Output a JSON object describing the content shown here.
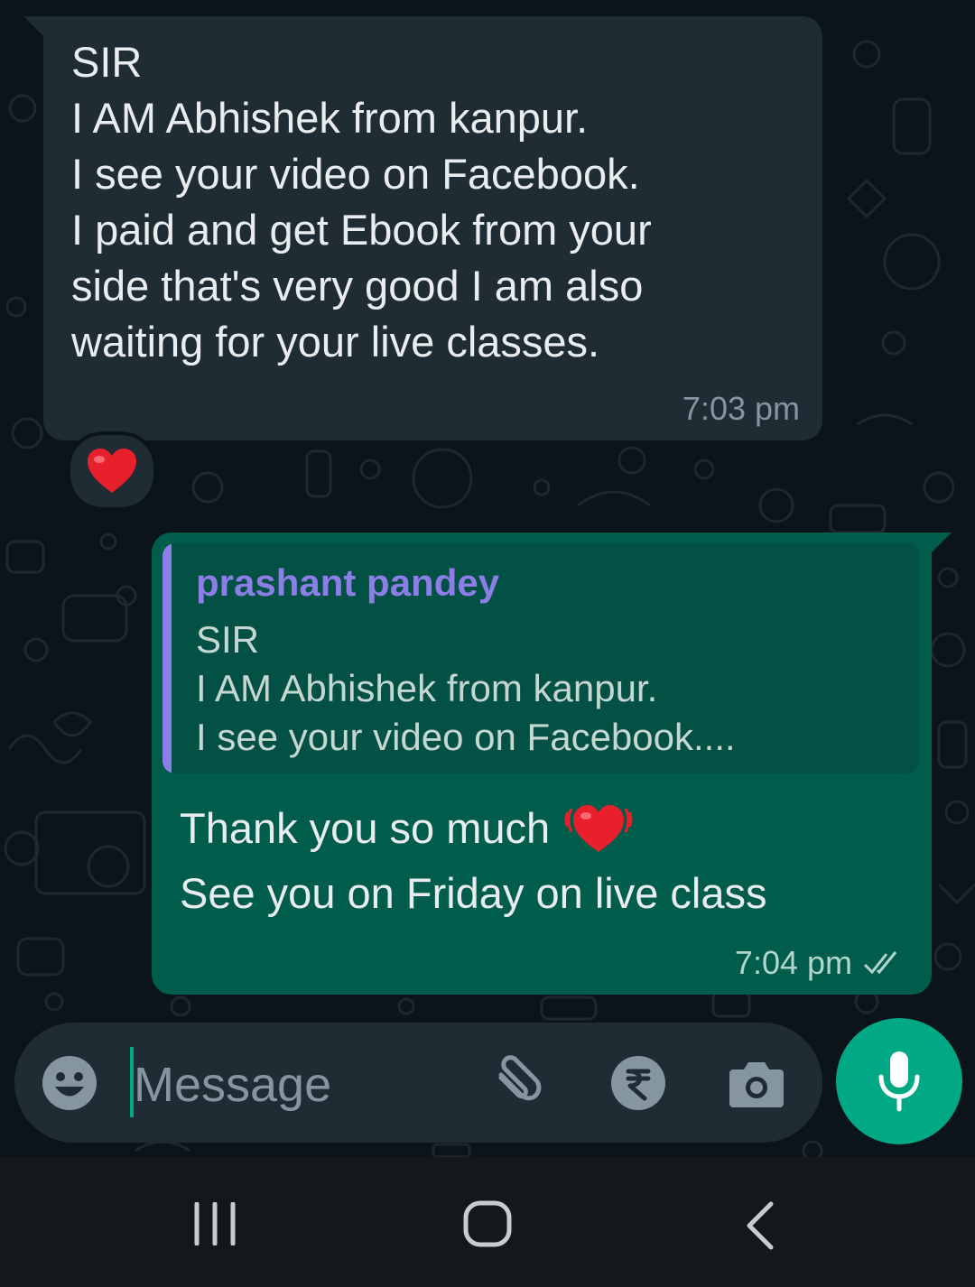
{
  "colors": {
    "background": "#0b141a",
    "incoming_bubble": "#202c33",
    "outgoing_bubble": "#005c4b",
    "quote_author": "#8c7ee6",
    "accent": "#00a884"
  },
  "messages": {
    "incoming": {
      "text": "SIR\nI AM Abhishek from kanpur.\nI see your video on Facebook.\nI paid and get Ebook from your\nside that's very good I am also\nwaiting for your live classes.",
      "time": "7:03 pm",
      "reaction": "heart-emoji"
    },
    "outgoing": {
      "quote": {
        "sender": "prashant pandey",
        "text": "SIR\nI AM Abhishek from kanpur.\nI see your video on Facebook...."
      },
      "line1": "Thank you so much",
      "line1_emoji": "beating-heart-emoji",
      "line2": "See you on Friday on live class",
      "time": "7:04 pm",
      "status_icon": "double-check-icon"
    }
  },
  "composer": {
    "placeholder": "Message",
    "icons": [
      "emoji-icon",
      "attach-icon",
      "rupee-icon",
      "camera-icon",
      "mic-icon"
    ]
  },
  "navigation": {
    "icons": [
      "recent-apps-icon",
      "home-icon",
      "back-icon"
    ]
  }
}
